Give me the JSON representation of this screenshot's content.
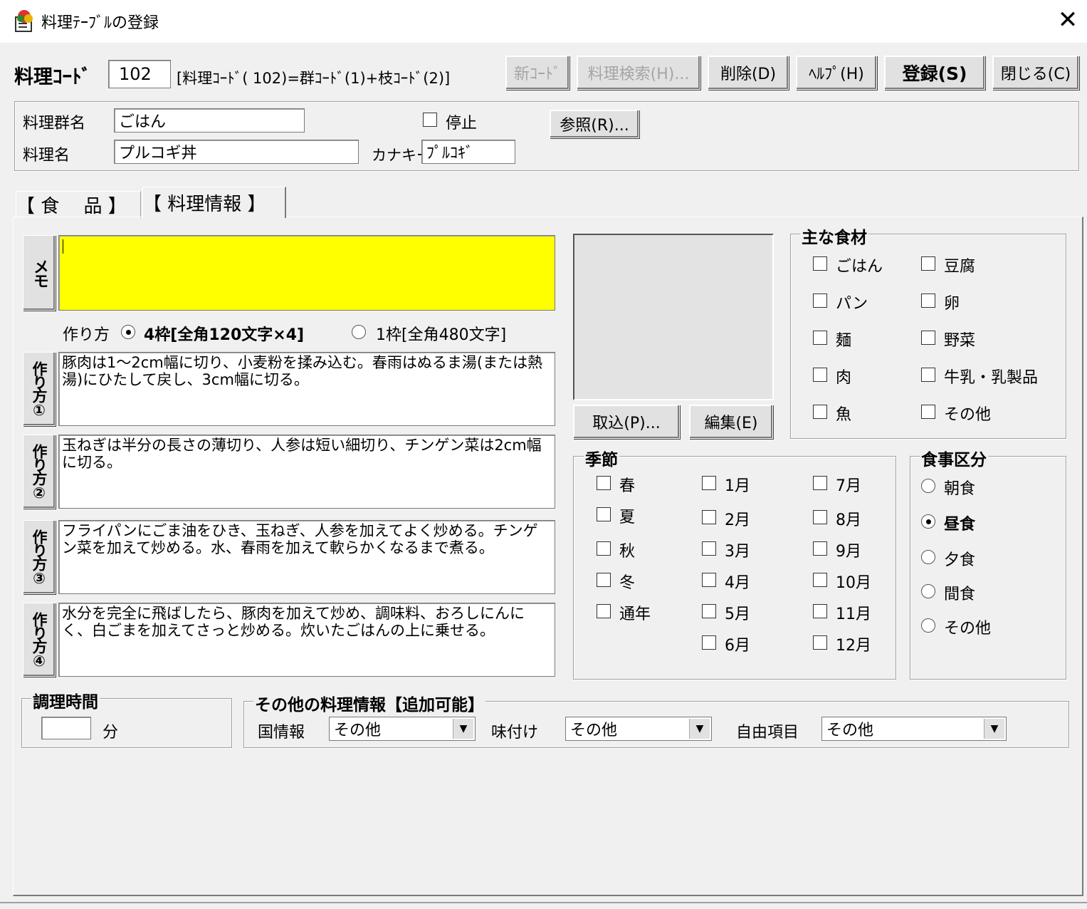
{
  "window": {
    "title": "料理ﾃｰﾌﾞﾙの登録",
    "close": "✕"
  },
  "header": {
    "code_label": "料理ｺｰﾄﾞ",
    "code_value": "102",
    "code_note": "[料理ｺｰﾄﾞ( 102)=群ｺｰﾄﾞ(1)+枝ｺｰﾄﾞ(2)]"
  },
  "toolbar": {
    "new_code": "新ｺｰﾄﾞ",
    "search": "料理検索(H)...",
    "delete": "削除(D)",
    "help": "ﾍﾙﾌﾟ(H)",
    "register": "登録(S)",
    "close": "閉じる(C)"
  },
  "info": {
    "group_label": "料理群名",
    "group_value": "ごはん",
    "stop_label": "停止",
    "ref_button": "参照(R)...",
    "name_label": "料理名",
    "name_value": "プルコギ丼",
    "kana_label": "カナキー",
    "kana_value": "ﾌﾟﾙｺｷﾞ"
  },
  "tabs": [
    {
      "label": "【 食 　品 】"
    },
    {
      "label": "【 料理情報 】"
    }
  ],
  "memo": {
    "label": "メモ",
    "value": "",
    "bg": "#ffff00"
  },
  "method_mode": {
    "label": "作り方",
    "option1": "4枠[全角120文字×4]",
    "option2": "1枠[全角480文字]",
    "selected": 1
  },
  "methods": [
    {
      "label": "作り方①",
      "text": "豚肉は1～2cm幅に切り、小麦粉を揉み込む。春雨はぬるま湯(または熱湯)にひたして戻し、3cm幅に切る。"
    },
    {
      "label": "作り方②",
      "text": "玉ねぎは半分の長さの薄切り、人参は短い細切り、チンゲン菜は2cm幅に切る。"
    },
    {
      "label": "作り方③",
      "text": "フライパンにごま油をひき、玉ねぎ、人参を加えてよく炒める。チンゲン菜を加えて炒める。水、春雨を加えて軟らかくなるまで煮る。"
    },
    {
      "label": "作り方④",
      "text": "水分を完全に飛ばしたら、豚肉を加えて炒め、調味料、おろしにんにく、白ごまを加えてさっと炒める。炊いたごはんの上に乗せる。"
    }
  ],
  "image_buttons": {
    "import": "取込(P)...",
    "edit": "編集(E)"
  },
  "main_ingredients": {
    "title": "主な食材",
    "items": [
      "ごはん",
      "豆腐",
      "パン",
      "卵",
      "麺",
      "野菜",
      "肉",
      "牛乳・乳製品",
      "魚",
      "その他"
    ]
  },
  "season": {
    "title": "季節",
    "seasons": [
      "春",
      "夏",
      "秋",
      "冬",
      "通年"
    ],
    "months": [
      "1月",
      "2月",
      "3月",
      "4月",
      "5月",
      "6月",
      "7月",
      "8月",
      "9月",
      "10月",
      "11月",
      "12月"
    ]
  },
  "meal": {
    "title": "食事区分",
    "options": [
      "朝食",
      "昼食",
      "夕食",
      "間食",
      "その他"
    ],
    "selected": "昼食"
  },
  "cook_time": {
    "title": "調理時間",
    "value": "",
    "unit": "分"
  },
  "other_info": {
    "title": "その他の料理情報【追加可能】",
    "country_label": "国情報",
    "country_value": "その他",
    "taste_label": "味付け",
    "taste_value": "その他",
    "free_label": "自由項目",
    "free_value": "その他"
  }
}
